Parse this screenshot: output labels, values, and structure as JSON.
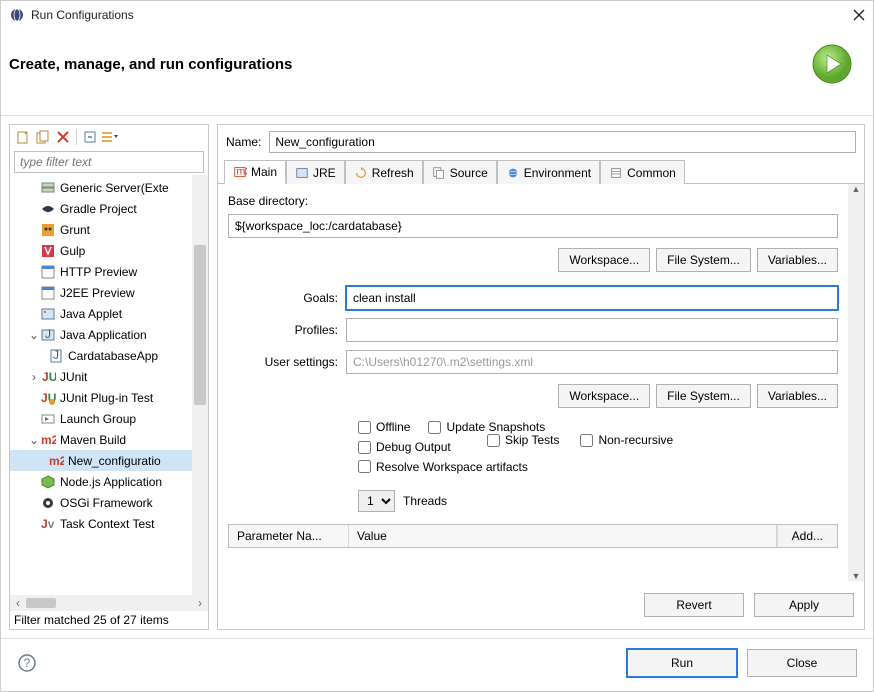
{
  "window": {
    "title": "Run Configurations"
  },
  "header": {
    "heading": "Create, manage, and run configurations"
  },
  "filter": {
    "placeholder": "type filter text",
    "status": "Filter matched 25 of 27 items"
  },
  "tree": [
    {
      "label": "Generic Server(Exte",
      "icon": "server"
    },
    {
      "label": "Gradle Project",
      "icon": "gradle"
    },
    {
      "label": "Grunt",
      "icon": "grunt"
    },
    {
      "label": "Gulp",
      "icon": "gulp"
    },
    {
      "label": "HTTP Preview",
      "icon": "http"
    },
    {
      "label": "J2EE Preview",
      "icon": "j2ee"
    },
    {
      "label": "Java Applet",
      "icon": "applet"
    },
    {
      "label": "Java Application",
      "icon": "java",
      "expanded": true,
      "children": [
        {
          "label": "CardatabaseApp",
          "icon": "javafile"
        }
      ]
    },
    {
      "label": "JUnit",
      "icon": "junit",
      "expandable": true
    },
    {
      "label": "JUnit Plug-in Test",
      "icon": "junit-plugin"
    },
    {
      "label": "Launch Group",
      "icon": "launch-group"
    },
    {
      "label": "Maven Build",
      "icon": "maven",
      "expanded": true,
      "children": [
        {
          "label": "New_configuratio",
          "icon": "maven",
          "selected": true
        }
      ]
    },
    {
      "label": "Node.js Application",
      "icon": "node"
    },
    {
      "label": "OSGi Framework",
      "icon": "osgi"
    },
    {
      "label": "Task Context Test",
      "icon": "task"
    }
  ],
  "form": {
    "name_label": "Name:",
    "name_value": "New_configuration",
    "tabs": [
      "Main",
      "JRE",
      "Refresh",
      "Source",
      "Environment",
      "Common"
    ],
    "base_dir_label": "Base directory:",
    "base_dir_value": "${workspace_loc:/cardatabase}",
    "workspace_btn": "Workspace...",
    "filesystem_btn": "File System...",
    "variables_btn": "Variables...",
    "goals_label": "Goals:",
    "goals_value": "clean install",
    "profiles_label": "Profiles:",
    "profiles_value": "",
    "user_settings_label": "User settings:",
    "user_settings_value": "C:\\Users\\h01270\\.m2\\settings.xml",
    "checks": {
      "offline": "Offline",
      "update": "Update Snapshots",
      "debug": "Debug Output",
      "skip": "Skip Tests",
      "nonrec": "Non-recursive",
      "resolve": "Resolve Workspace artifacts"
    },
    "threads_value": "1",
    "threads_label": "Threads",
    "param_name_col": "Parameter Na...",
    "param_value_col": "Value",
    "add_btn": "Add..."
  },
  "actions": {
    "revert": "Revert",
    "apply": "Apply"
  },
  "footer": {
    "run": "Run",
    "close": "Close"
  }
}
